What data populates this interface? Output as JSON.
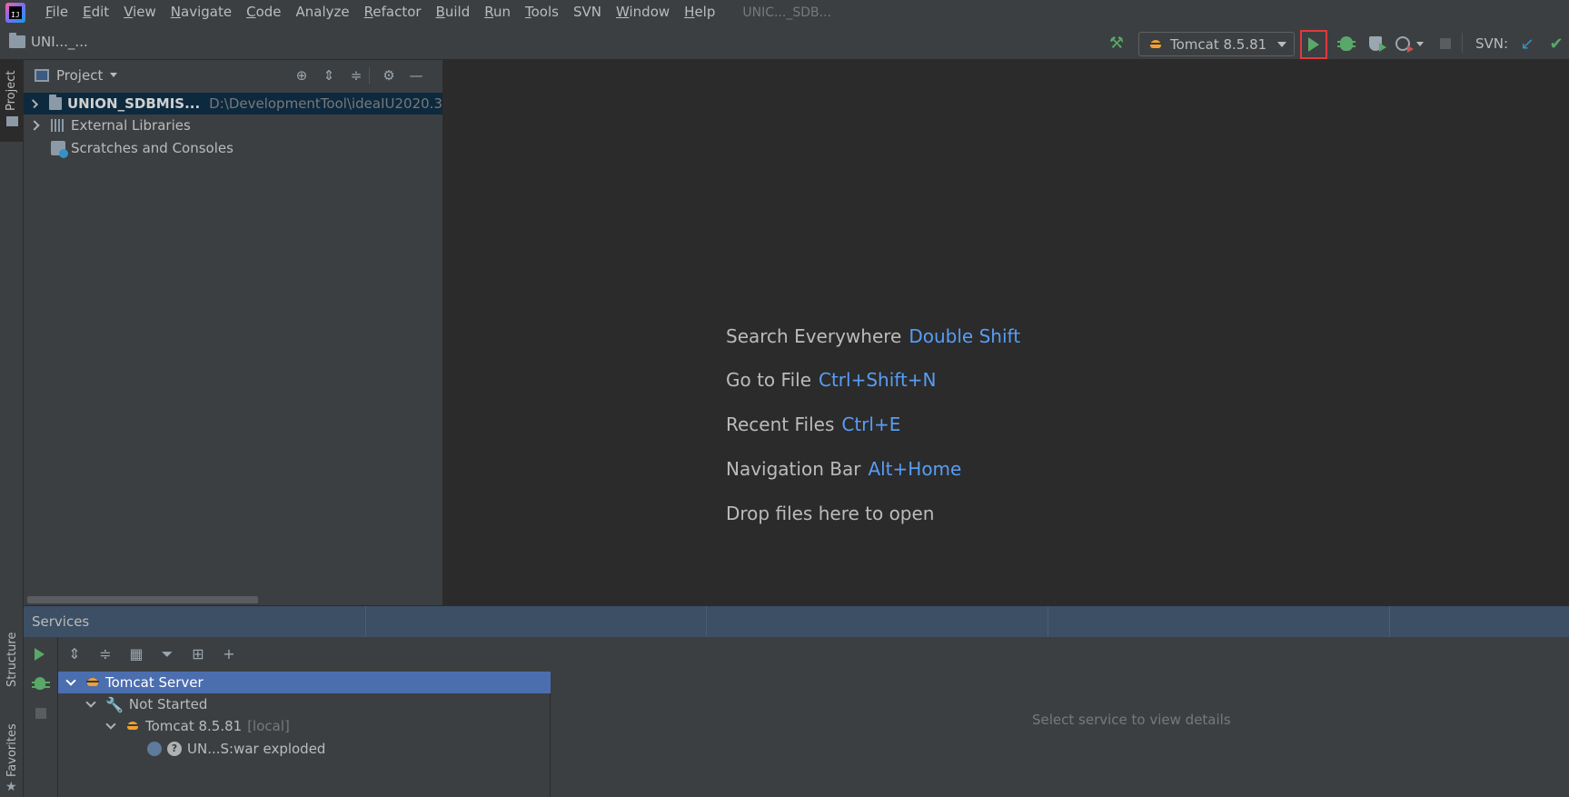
{
  "menubar": {
    "items": [
      {
        "mnemonic": "F",
        "rest": "ile"
      },
      {
        "mnemonic": "E",
        "rest": "dit"
      },
      {
        "mnemonic": "V",
        "rest": "iew"
      },
      {
        "mnemonic": "N",
        "rest": "avigate"
      },
      {
        "mnemonic": "C",
        "rest": "ode"
      },
      {
        "mnemonic": "",
        "rest": "Analyze"
      },
      {
        "mnemonic": "R",
        "rest": "efactor"
      },
      {
        "mnemonic": "B",
        "rest": "uild"
      },
      {
        "mnemonic": "R",
        "rest": "un"
      },
      {
        "mnemonic": "T",
        "rest": "ools"
      },
      {
        "mnemonic": "",
        "rest": "SVN"
      },
      {
        "mnemonic": "W",
        "rest": "indow"
      },
      {
        "mnemonic": "H",
        "rest": "elp"
      }
    ],
    "window_title": "UNIC..._SDB..."
  },
  "navbar": {
    "project_name": "UNI..._..."
  },
  "toolbar": {
    "run_config_label": "Tomcat 8.5.81",
    "svn_label": "SVN:",
    "run_icon": "play-icon",
    "debug_icon": "bug-icon",
    "coverage_icon": "coverage-icon",
    "profile_icon": "profiler-icon",
    "stop_icon": "stop-icon",
    "build_icon": "hammer-icon",
    "svn_update_icon": "arrow-down-left-icon",
    "svn_commit_icon": "check-icon"
  },
  "left_strip": {
    "project_tab": "Project",
    "structure_tab": "Structure",
    "favorites_tab": "Favorites"
  },
  "project_panel": {
    "title": "Project",
    "tree": [
      {
        "label": "UNION_SDBMIS...",
        "path": "D:\\DevelopmentTool\\ideaIU2020.3",
        "expanded": false,
        "selected": true
      },
      {
        "label": "External Libraries",
        "expanded": false
      },
      {
        "label": "Scratches and Consoles"
      }
    ]
  },
  "editor": {
    "hints": [
      {
        "label": "Search Everywhere",
        "shortcut": "Double Shift"
      },
      {
        "label": "Go to File",
        "shortcut": "Ctrl+Shift+N"
      },
      {
        "label": "Recent Files",
        "shortcut": "Ctrl+E"
      },
      {
        "label": "Navigation Bar",
        "shortcut": "Alt+Home"
      },
      {
        "label": "Drop files here to open",
        "shortcut": ""
      }
    ]
  },
  "services": {
    "title": "Services",
    "empty_message": "Select service to view details",
    "tree": {
      "server": "Tomcat Server",
      "state": "Not Started",
      "instance": "Tomcat 8.5.81",
      "instance_suffix": "[local]",
      "artifact": "UN...S:war exploded"
    }
  },
  "colors": {
    "accent_blue": "#589df6",
    "run_green": "#59a869",
    "highlight_red": "#e0393e",
    "selection": "#4b6eaf"
  }
}
